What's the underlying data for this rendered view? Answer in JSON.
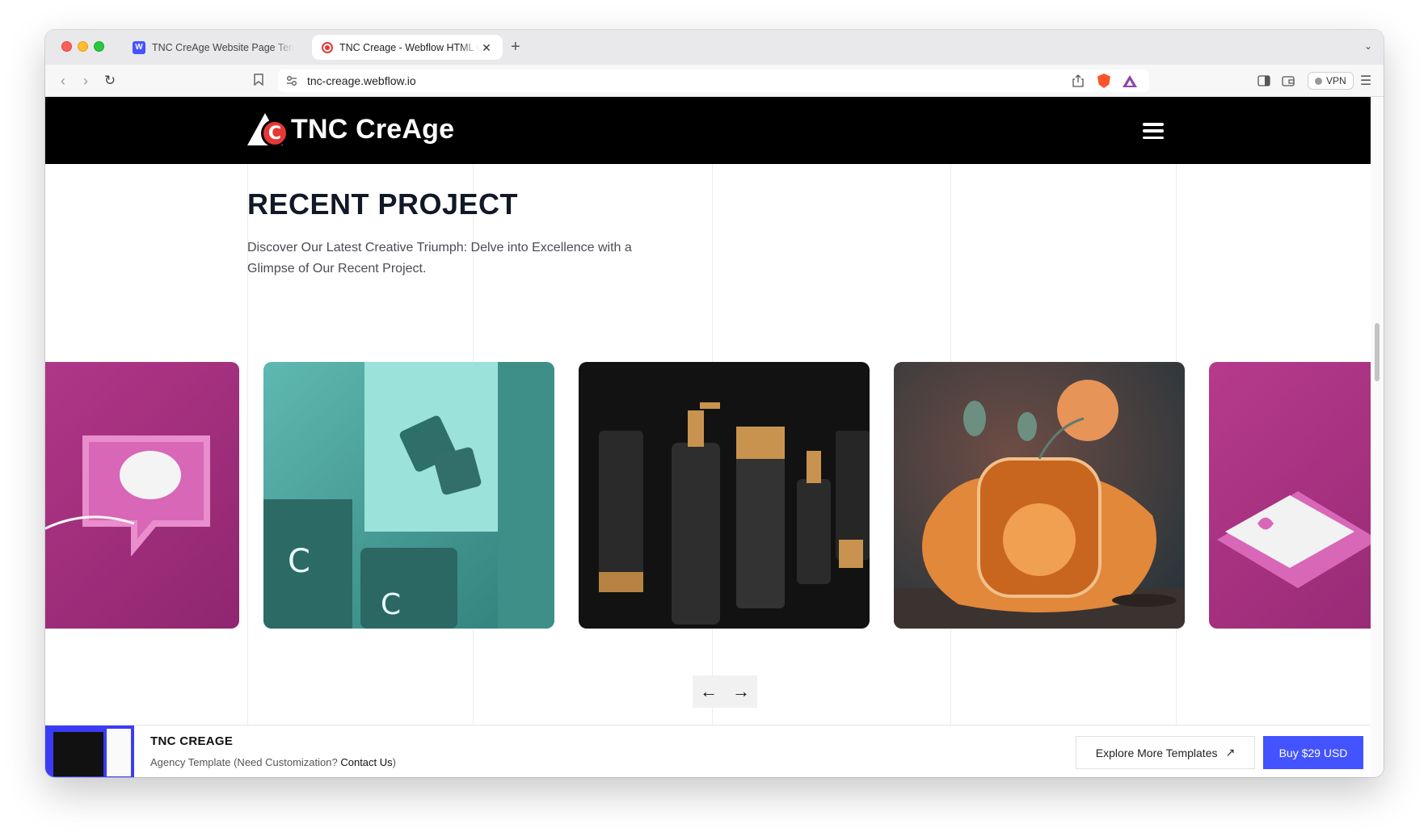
{
  "browser": {
    "tabs": [
      {
        "title": "TNC CreAge Website Page Template",
        "active": false,
        "icon": "webflow-icon"
      },
      {
        "title": "TNC Creage - Webflow HTML website template",
        "active": true,
        "icon": "creage-icon"
      }
    ],
    "url": "tnc-creage.webflow.io",
    "vpn_label": "VPN"
  },
  "site": {
    "logo_text": "TNC CreAge",
    "logo_mark_letter": "C"
  },
  "section": {
    "title": "RECENT PROJECT",
    "description": "Discover Our Latest Creative Triumph: Delve into Excellence with a Glimpse of Our Recent Project."
  },
  "carousel": {
    "cards": [
      {
        "subject": "pink-heart-sign",
        "colors": [
          "#a8327f",
          "#e486c8"
        ]
      },
      {
        "subject": "teal-cosmetic-jars",
        "colors": [
          "#3f958f",
          "#8fded6"
        ]
      },
      {
        "subject": "black-cosmetic-bottles",
        "colors": [
          "#111111",
          "#c8934e"
        ]
      },
      {
        "subject": "perfume-flower-splash",
        "colors": [
          "#2f3a3e",
          "#e18a3c"
        ]
      },
      {
        "subject": "pink-keyboard-heart",
        "colors": [
          "#a8327f",
          "#f2f2f2"
        ]
      }
    ],
    "prev_label": "←",
    "next_label": "→"
  },
  "promo": {
    "title": "TNC CREAGE",
    "subtitle_prefix": "Agency Template (Need Customization?",
    "contact_label": "Contact Us",
    "subtitle_suffix": ")",
    "explore_label": "Explore More Templates",
    "explore_icon": "↗",
    "buy_label": "Buy $29 USD"
  },
  "colors": {
    "accent": "#4353ff",
    "brand_red": "#e53935",
    "header_bg": "#000000"
  }
}
